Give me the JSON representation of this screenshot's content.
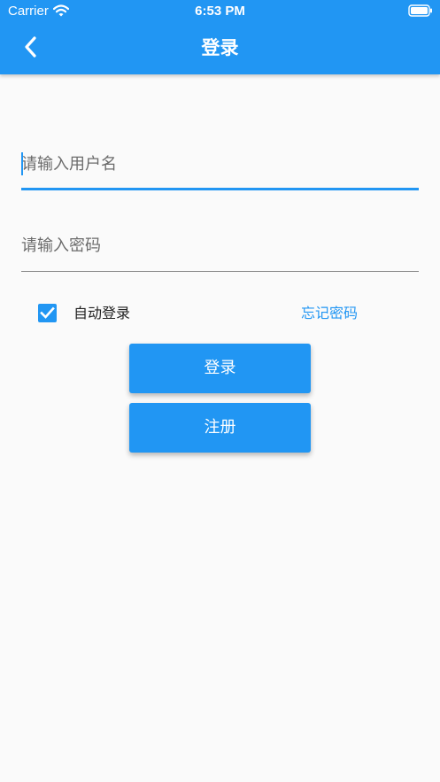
{
  "status_bar": {
    "carrier": "Carrier",
    "time": "6:53 PM"
  },
  "app_bar": {
    "title": "登录",
    "back_icon": "chevron-left-icon",
    "color": "#2196f3"
  },
  "form": {
    "username": {
      "placeholder": "请输入用户名",
      "value": ""
    },
    "password": {
      "placeholder": "请输入密码",
      "value": ""
    },
    "remember": {
      "label": "自动登录",
      "checked": true
    },
    "forgot_password": "忘记密码"
  },
  "buttons": {
    "login": "登录",
    "register": "注册"
  }
}
